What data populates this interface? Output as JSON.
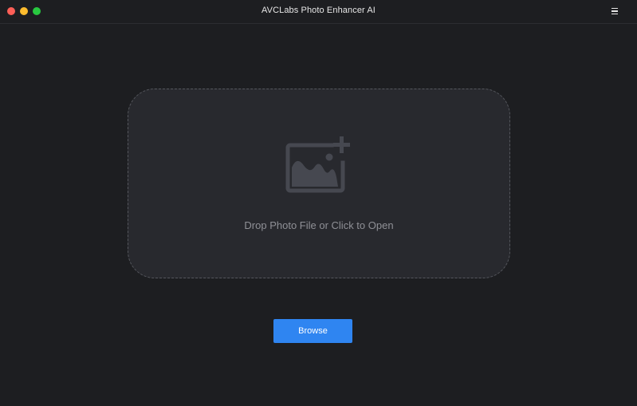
{
  "window": {
    "title": "AVCLabs Photo Enhancer AI"
  },
  "titlebar": {
    "menu_icon": "hamburger-menu-icon"
  },
  "dropzone": {
    "icon": "add-photo-icon",
    "text": "Drop Photo File or Click to Open"
  },
  "browse": {
    "label": "Browse"
  },
  "colors": {
    "background": "#1d1e21",
    "dropzone_fill": "#28292e",
    "icon": "#464850",
    "accent": "#2f85f1"
  }
}
